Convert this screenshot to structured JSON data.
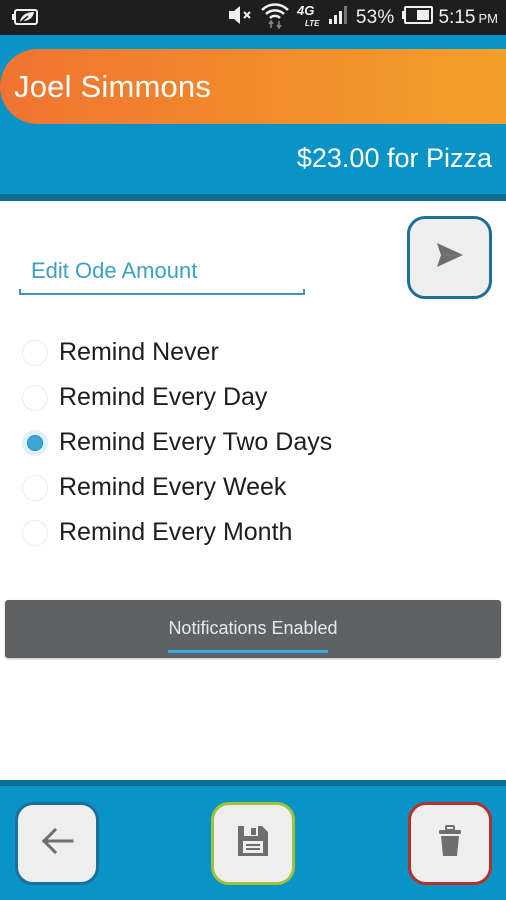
{
  "status_bar": {
    "left_icon": "leaf-battery-saver-icon",
    "icons": [
      "mute-icon",
      "wifi-icon",
      "4g-lte-icon",
      "signal-icon",
      "battery-icon"
    ],
    "network_label": "4G LTE",
    "battery_percent": "53%",
    "time": "5:15",
    "ampm": "PM"
  },
  "header": {
    "name": "Joel Simmons",
    "amount_text": "$23.00 for Pizza"
  },
  "edit": {
    "placeholder": "Edit Ode Amount",
    "value": ""
  },
  "send_button": {
    "icon": "send-icon"
  },
  "reminder_options": [
    {
      "label": "Remind Never",
      "checked": false
    },
    {
      "label": "Remind Every Day",
      "checked": false
    },
    {
      "label": "Remind Every Two Days",
      "checked": true
    },
    {
      "label": "Remind Every Week",
      "checked": false
    },
    {
      "label": "Remind Every Month",
      "checked": false
    }
  ],
  "notifications": {
    "label": "Notifications Enabled",
    "enabled": true
  },
  "bottom_bar": {
    "back_icon": "arrow-left-icon",
    "save_icon": "floppy-disk-icon",
    "delete_icon": "trash-icon"
  },
  "colors": {
    "header_blue": "#0a93c6",
    "header_dark_blue": "#0c6d99",
    "name_gradient_start": "#ef7430",
    "name_gradient_end": "#f3a02a",
    "accent_text": "#3f9ec4",
    "radio_checked": "#3ba7d6",
    "notif_bg": "#5f6265",
    "notif_indicator": "#34aadf",
    "save_border": "#9dc33b",
    "delete_border": "#b6302b",
    "back_border": "#1a6f9b"
  }
}
